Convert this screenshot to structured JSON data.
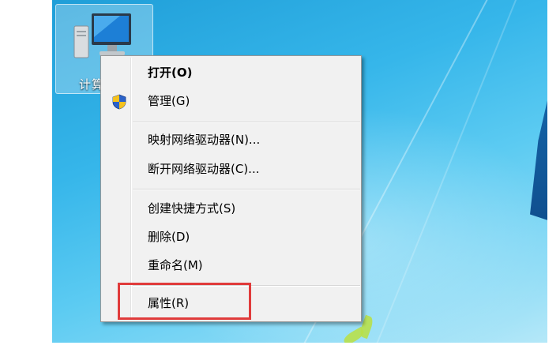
{
  "desktop": {
    "icon_label": "计算机"
  },
  "context_menu": {
    "items": [
      {
        "label": "打开(O)",
        "bold": true
      },
      {
        "label": "管理(G)",
        "icon": "uac-shield-icon"
      },
      {
        "label": "映射网络驱动器(N)..."
      },
      {
        "label": "断开网络驱动器(C)..."
      },
      {
        "label": "创建快捷方式(S)"
      },
      {
        "label": "删除(D)"
      },
      {
        "label": "重命名(M)"
      },
      {
        "label": "属性(R)",
        "highlighted": true
      }
    ]
  },
  "colors": {
    "highlight_border": "#e03b3b",
    "menu_background": "#f1f1f1",
    "desktop_blue": "#36b6ea"
  }
}
